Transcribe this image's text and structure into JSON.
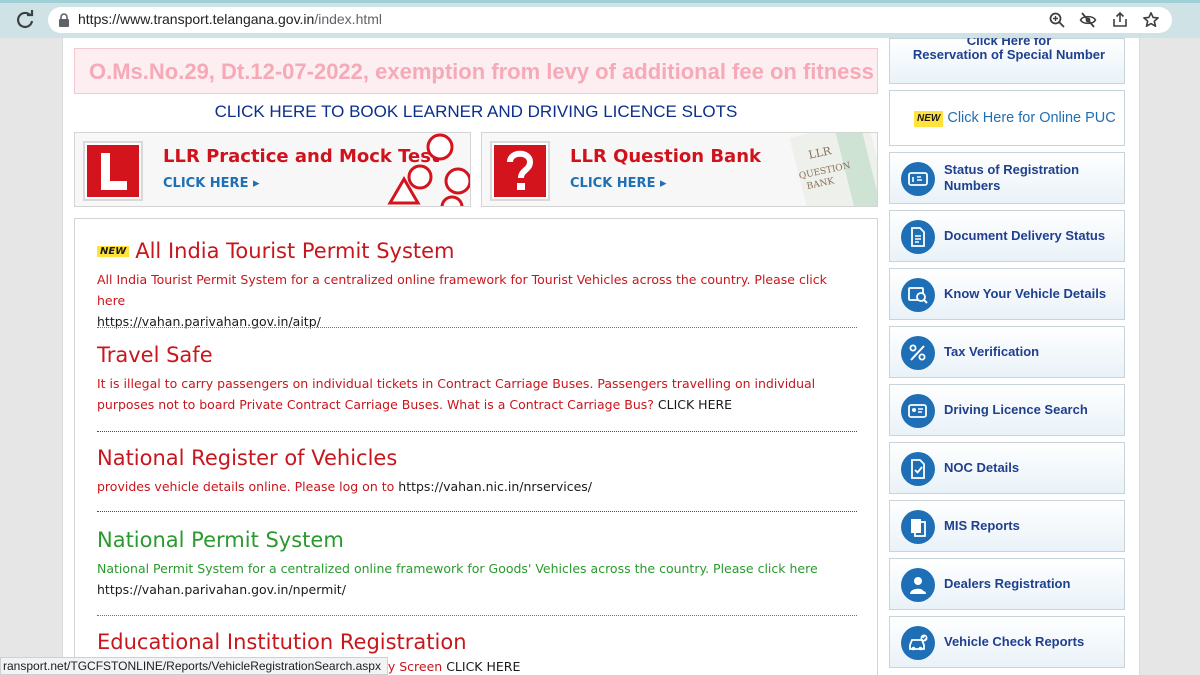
{
  "browser": {
    "url_host": "https://www.transport.telangana.gov.in",
    "url_path": "/index.html",
    "status_url": "ransport.net/TGCFSTONLINE/Reports/VehicleRegistrationSearch.aspx"
  },
  "marquee": {
    "text": "O.Ms.No.29, Dt.12-07-2022, exemption from levy of additional fee on fitness ce"
  },
  "book_slots_link": "CLICK HERE TO BOOK LEARNER AND DRIVING LICENCE SLOTS",
  "banners": [
    {
      "title": "LLR Practice and Mock Test",
      "cta": "CLICK HERE ▸"
    },
    {
      "title": "LLR Question Bank",
      "cta": "CLICK HERE ▸",
      "deco_title": "LLR",
      "deco_sub1": "QUESTION",
      "deco_sub2": "BANK"
    }
  ],
  "news": [
    {
      "badge": "NEW",
      "title": "All India Tourist Permit System",
      "desc": "All India Tourist Permit System for a centralized online framework for Tourist Vehicles across the country. Please click here",
      "link": "https://vahan.parivahan.gov.in/aitp/"
    },
    {
      "title": "Travel Safe",
      "desc": "It is illegal to carry passengers on individual tickets in Contract Carriage Buses. Passengers travelling on individual purposes not to board Private Contract Carriage Buses. What is a Contract Carriage Bus?",
      "link": "CLICK HERE"
    },
    {
      "title": "National Register of Vehicles",
      "desc": "provides vehicle details online. Please log on to",
      "link": "https://vahan.nic.in/nrservices/"
    },
    {
      "title": "National Permit System",
      "desc": "National Permit System for a centralized online framework for Goods' Vehicles across the country. Please click here",
      "link": "https://vahan.parivahan.gov.in/npermit/"
    },
    {
      "title": "Educational Institution Registration",
      "desc": "Entry Screen",
      "link": "CLICK HERE"
    }
  ],
  "sidebar": {
    "special_number": {
      "line1": "Click Here for",
      "line2": "Reservation of Special Number"
    },
    "puc": {
      "badge": "NEW",
      "label": "Click Here for Online PUC"
    },
    "items": [
      {
        "label": "Status of Registration Numbers",
        "icon": "registration-status-icon"
      },
      {
        "label": "Document Delivery Status",
        "icon": "document-delivery-icon"
      },
      {
        "label": "Know Your Vehicle Details",
        "icon": "vehicle-details-icon"
      },
      {
        "label": "Tax Verification",
        "icon": "tax-percent-icon"
      },
      {
        "label": "Driving Licence Search",
        "icon": "licence-search-icon"
      },
      {
        "label": "NOC Details",
        "icon": "noc-document-icon"
      },
      {
        "label": "MIS Reports",
        "icon": "mis-reports-icon"
      },
      {
        "label": "Dealers Registration",
        "icon": "dealer-icon"
      },
      {
        "label": "Vehicle Check Reports",
        "icon": "vehicle-check-icon"
      }
    ]
  },
  "colors": {
    "heading_red": "#c8161d",
    "heading_green": "#2a9a2e",
    "link_blue": "#0b2f8a",
    "side_icon_blue": "#1f6fb6"
  }
}
